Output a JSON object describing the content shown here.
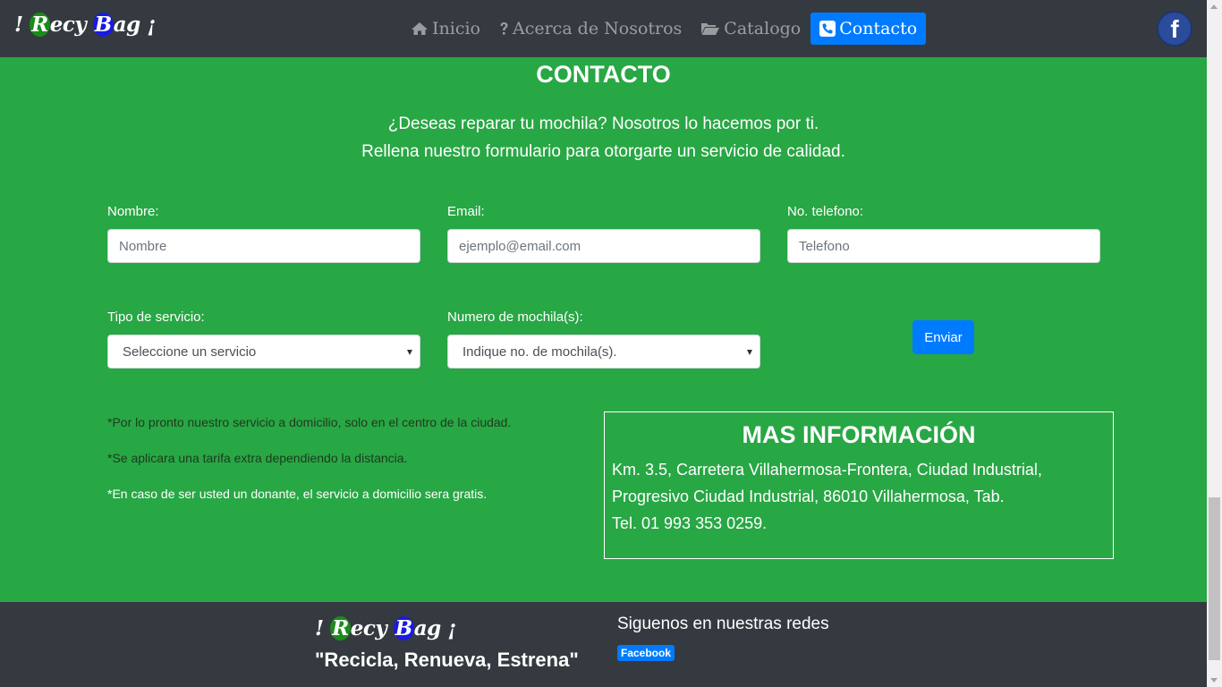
{
  "navbar": {
    "brand": {
      "open": "!",
      "c1": "R",
      "rest1": "ecy ",
      "c2": "B",
      "rest2": "ag",
      "close": "¡"
    },
    "items": [
      {
        "label": "Inicio",
        "icon": "home-icon"
      },
      {
        "label": "Acerca de Nosotros",
        "icon": "question-icon"
      },
      {
        "label": "Catalogo",
        "icon": "folder-open-icon"
      },
      {
        "label": "Contacto",
        "icon": "phone-icon",
        "active": true
      }
    ],
    "facebook_icon": "f"
  },
  "contact": {
    "title": "CONTACTO",
    "intro1": "¿Deseas reparar tu mochila? Nosotros lo hacemos por ti.",
    "intro2": "Rellena nuestro formulario para otorgarte un servicio de calidad."
  },
  "form": {
    "name_label": "Nombre:",
    "name_placeholder": "Nombre",
    "email_label": "Email:",
    "email_placeholder": "ejemplo@email.com",
    "phone_label": "No. telefono:",
    "phone_placeholder": "Telefono",
    "service_label": "Tipo de servicio:",
    "service_selected": "Seleccione un servicio",
    "count_label": "Numero de mochila(s):",
    "count_selected": "Indique no. de mochila(s).",
    "submit_label": "Enviar"
  },
  "notes": [
    "*Por lo pronto nuestro servicio a domicilio, solo en el centro de la ciudad.",
    "*Se aplicara una tarifa extra dependiendo la distancia.",
    "*En caso de ser usted un donante, el servicio a domicilio sera gratis."
  ],
  "info": {
    "title": "MAS INFORMACIÓN",
    "line1": "Km. 3.5, Carretera Villahermosa-Frontera, Ciudad Industrial,",
    "line2": "Progresivo Ciudad Industrial, 86010 Villahermosa, Tab.",
    "line3": "Tel. 01 993 353 0259."
  },
  "footer": {
    "slogan": "\"Recicla, Renueva, Estrena\"",
    "follow": "Siguenos en nuestras redes",
    "facebook_badge": "Facebook"
  },
  "colors": {
    "page_bg": "#28a745",
    "navbar_bg": "#343a40",
    "accent": "#007bff"
  }
}
